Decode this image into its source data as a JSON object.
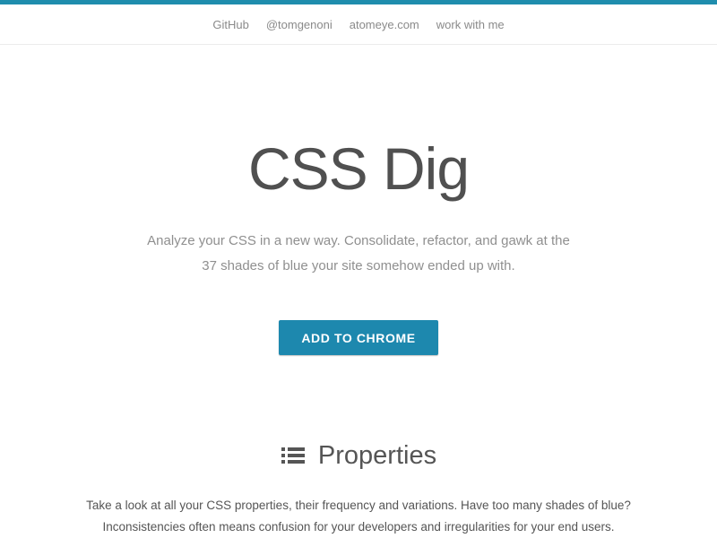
{
  "colors": {
    "accent": "#1f8dad",
    "button": "#1d88ae",
    "nav_text": "#8a8a8a"
  },
  "nav": {
    "links": [
      "GitHub",
      "@tomgenoni",
      "atomeye.com",
      "work with me"
    ]
  },
  "hero": {
    "title": "CSS Dig",
    "subtitle_line1": "Analyze your CSS in a new way. Consolidate, refactor, and gawk at the",
    "subtitle_line2": "37 shades of blue your site somehow ended up with.",
    "cta_label": "ADD TO CHROME"
  },
  "properties": {
    "icon": "list-icon",
    "heading": "Properties",
    "text_line1": "Take a look at all your CSS properties, their frequency and variations. Have too many shades of blue?",
    "text_line2": "Inconsistencies often means confusion for your developers and irregularities for your end users."
  }
}
